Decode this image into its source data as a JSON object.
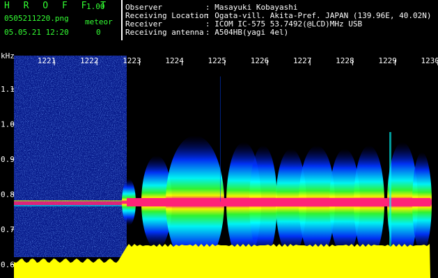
{
  "header": {
    "app_name": "H R O F F T",
    "app_version": "1.00",
    "filename": "0505211220.png",
    "mode": "meteor",
    "datetime": "05.05.21 12:20",
    "count": "0"
  },
  "station": [
    {
      "key": "Observer",
      "value": ": Masayuki Kobayashi"
    },
    {
      "key": "Receiving Location",
      "value": ": Ogata-vill. Akita-Pref. JAPAN (139.96E, 40.02N)"
    },
    {
      "key": "Receiver",
      "value": ": ICOM IC-575 53.7492(@LCD)MHz USB"
    },
    {
      "key": "Receiving antenna",
      "value": ": A504HB(yagi 4el)"
    }
  ],
  "spectrogram": {
    "y_unit": "kHz",
    "y_ticks": [
      "1.1",
      "1.0",
      "0.9",
      "0.8",
      "0.7",
      "0.6"
    ],
    "x_ticks": [
      "1221",
      "1222",
      "1223",
      "1224",
      "1225",
      "1226",
      "1227",
      "1228",
      "1229",
      "1230"
    ]
  },
  "colors": {
    "background": "#000000",
    "header_text": "#33ff33",
    "info_text": "#ffffff",
    "tick_text": "#ffffff",
    "level_fill": "#ffff00",
    "echo_core": "#ff2277"
  }
}
